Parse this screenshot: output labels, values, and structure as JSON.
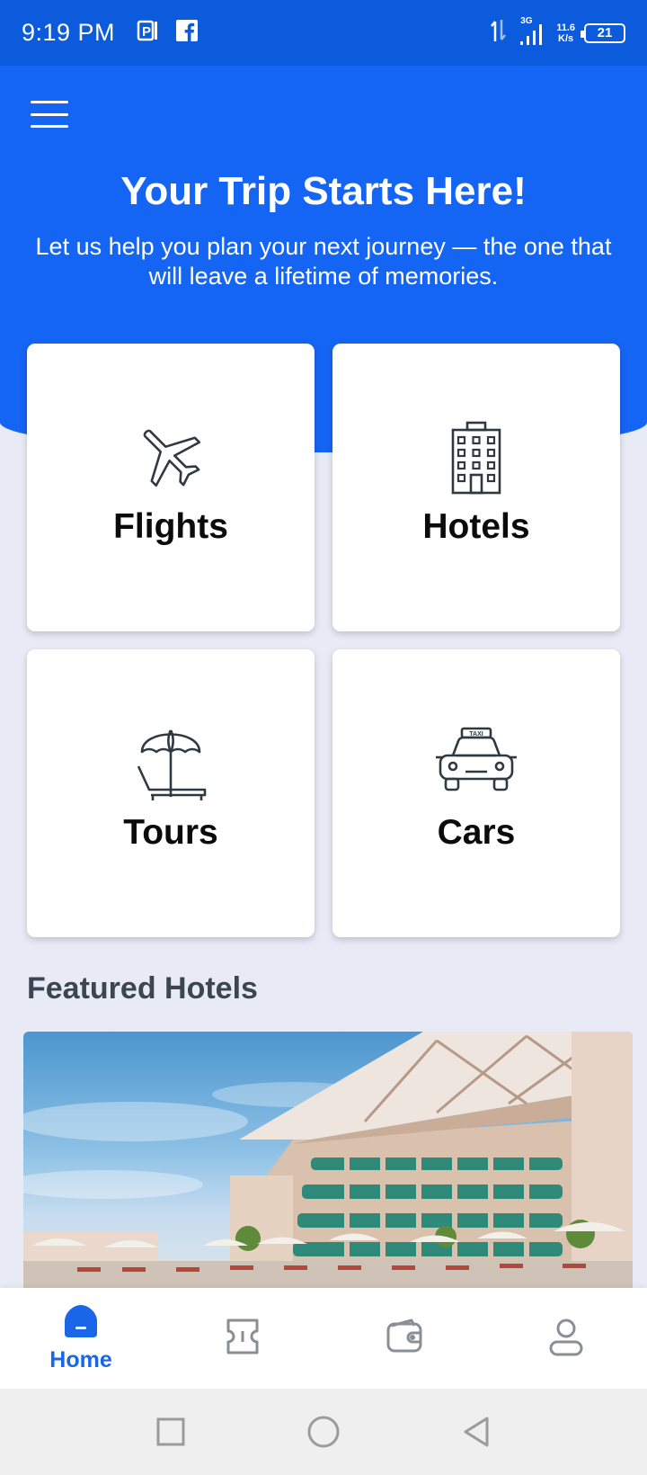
{
  "status_bar": {
    "time": "9:19 PM",
    "network_type": "3G",
    "net_speed_value": "11.6",
    "net_speed_unit": "K/s",
    "battery": "21",
    "icons": [
      "parking-app-icon",
      "facebook-icon",
      "data-transfer-icon",
      "signal-icon"
    ]
  },
  "header": {
    "menu_icon": "hamburger-menu-icon",
    "title": "Your Trip Starts Here!",
    "subtitle": "Let us help you plan your next journey — the one that will leave a lifetime of memories."
  },
  "categories": [
    {
      "label": "Flights",
      "icon": "airplane-icon"
    },
    {
      "label": "Hotels",
      "icon": "building-icon"
    },
    {
      "label": "Tours",
      "icon": "beach-umbrella-icon"
    },
    {
      "label": "Cars",
      "icon": "taxi-icon"
    }
  ],
  "taxi_sign": "TAXI",
  "featured": {
    "title": "Featured Hotels"
  },
  "tab_bar": {
    "items": [
      {
        "label": "Home",
        "icon": "home-icon",
        "active": true
      },
      {
        "label": "",
        "icon": "ticket-icon",
        "active": false
      },
      {
        "label": "",
        "icon": "wallet-icon",
        "active": false
      },
      {
        "label": "",
        "icon": "profile-icon",
        "active": false
      }
    ]
  },
  "colors": {
    "status_bar": "#0b5bdc",
    "header": "#1565f5",
    "background": "#e8ebf6",
    "accent": "#1a66e8",
    "card_text": "#0b0b0b",
    "section_title": "#3b4650",
    "icon_stroke": "#2f3940"
  }
}
